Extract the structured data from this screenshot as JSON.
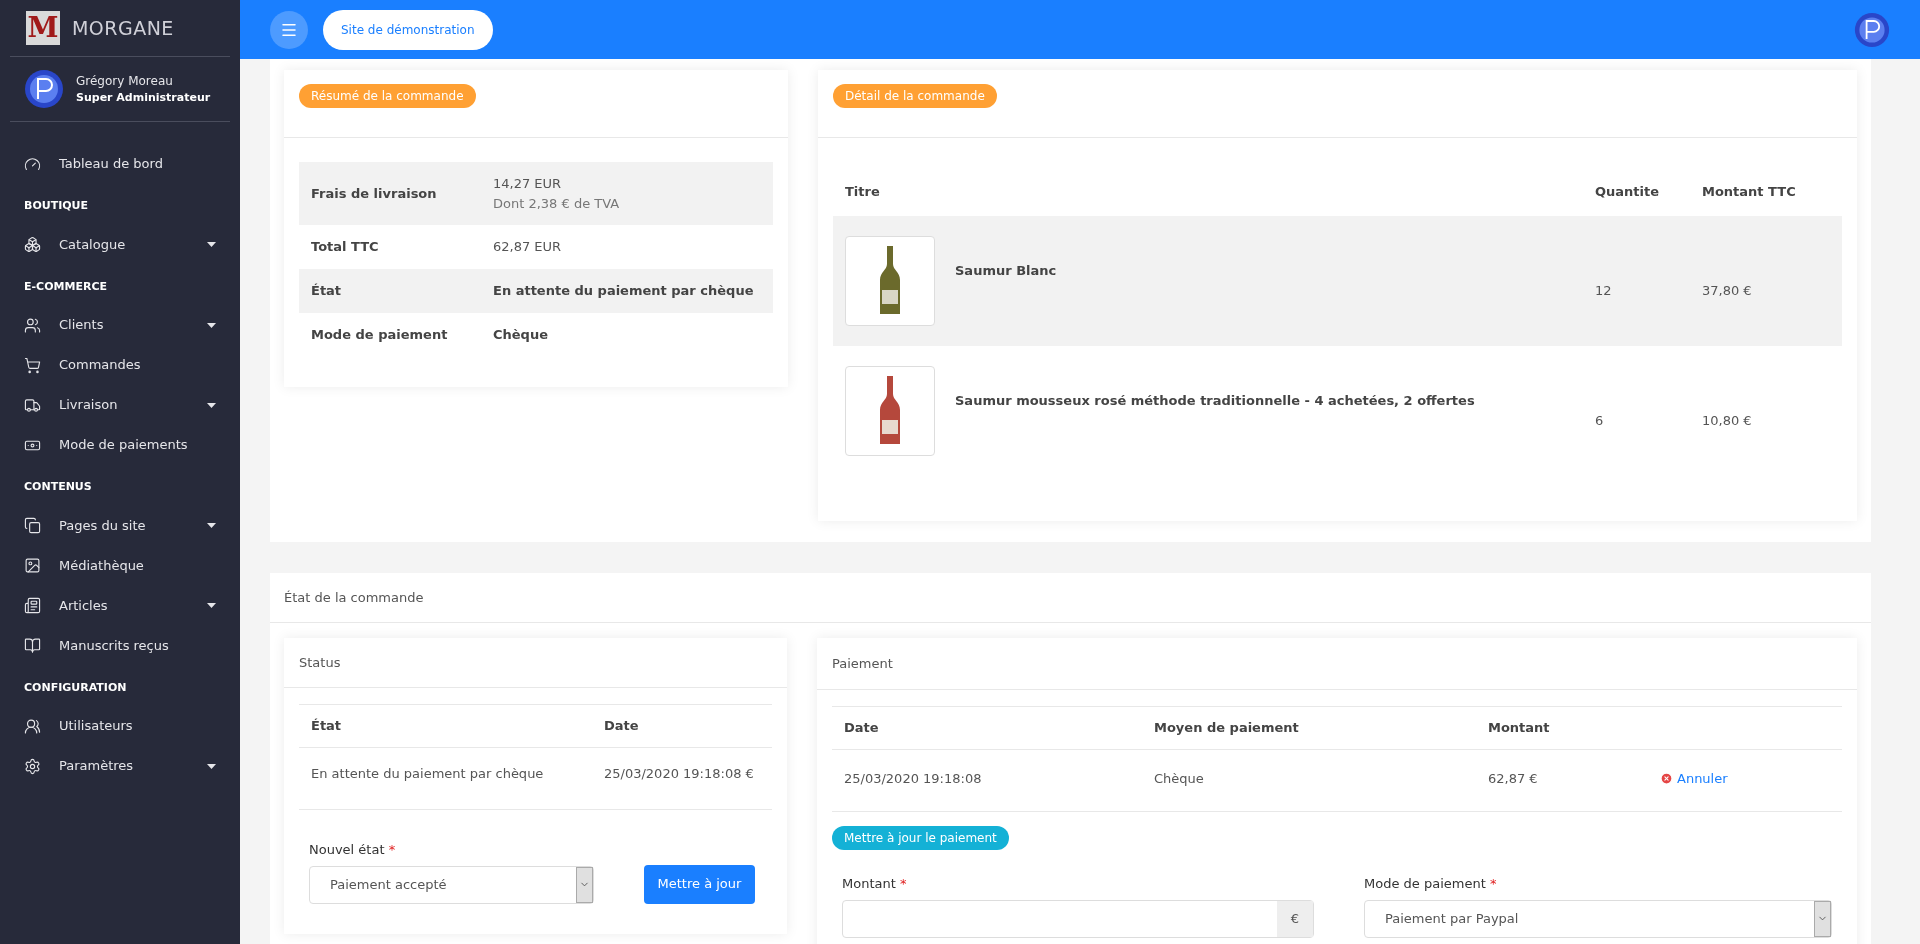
{
  "brand": {
    "logo_letter": "M",
    "name": "MORGANE"
  },
  "user": {
    "name": "Grégory Moreau",
    "role": "Super Administrateur"
  },
  "sidebar": {
    "items": [
      {
        "kind": "item",
        "label": "Tableau de bord",
        "expandable": false
      },
      {
        "kind": "section",
        "label": "BOUTIQUE"
      },
      {
        "kind": "item",
        "label": "Catalogue",
        "expandable": true
      },
      {
        "kind": "section",
        "label": "E-COMMERCE"
      },
      {
        "kind": "item",
        "label": "Clients",
        "expandable": true
      },
      {
        "kind": "item",
        "label": "Commandes",
        "expandable": false
      },
      {
        "kind": "item",
        "label": "Livraison",
        "expandable": true
      },
      {
        "kind": "item",
        "label": "Mode de paiements",
        "expandable": false
      },
      {
        "kind": "section",
        "label": "CONTENUS"
      },
      {
        "kind": "item",
        "label": "Pages du site",
        "expandable": true
      },
      {
        "kind": "item",
        "label": "Médiathèque",
        "expandable": false
      },
      {
        "kind": "item",
        "label": "Articles",
        "expandable": true
      },
      {
        "kind": "item",
        "label": "Manuscrits reçus",
        "expandable": false
      },
      {
        "kind": "section",
        "label": "CONFIGURATION"
      },
      {
        "kind": "item",
        "label": "Utilisateurs",
        "expandable": false
      },
      {
        "kind": "item",
        "label": "Paramètres",
        "expandable": true
      }
    ]
  },
  "topbar": {
    "site_button": "Site de démonstration"
  },
  "summary": {
    "badge": "Résumé de la commande",
    "rows": [
      {
        "label": "Frais de livraison",
        "value": "14,27 EUR",
        "note": "Dont 2,38 € de TVA",
        "bold": false
      },
      {
        "label": "Total TTC",
        "value": "62,87 EUR",
        "bold": false
      },
      {
        "label": "État",
        "value": "En attente du paiement par chèque",
        "bold": true
      },
      {
        "label": "Mode de paiement",
        "value": "Chèque",
        "bold": true
      }
    ]
  },
  "detail": {
    "badge": "Détail de la commande",
    "columns": [
      "Titre",
      "Quantite",
      "Montant TTC"
    ],
    "rows": [
      {
        "kind": "still",
        "title": "Saumur Blanc",
        "quantity": "12",
        "amount": "37,80 €"
      },
      {
        "kind": "sparkling",
        "title": "Saumur mousseux rosé méthode traditionnelle - 4 achetées, 2 offertes",
        "quantity": "6",
        "amount": "10,80 €"
      }
    ]
  },
  "order_state": {
    "title": "État de la commande",
    "status": {
      "title": "Status",
      "columns": [
        "État",
        "Date"
      ],
      "rows": [
        [
          "En attente du paiement par chèque",
          "25/03/2020 19:18:08 €"
        ]
      ],
      "new_state_label": "Nouvel état",
      "required_mark": "*",
      "new_state_value": "Paiement accepté",
      "button": "Mettre à jour"
    },
    "payment": {
      "title": "Paiement",
      "columns": [
        "Date",
        "Moyen de paiement",
        "Montant"
      ],
      "rows": [
        {
          "date": "25/03/2020 19:18:08",
          "method": "Chèque",
          "amount": "62,87 €",
          "action": "Annuler"
        }
      ],
      "badge": "Mettre à jour le paiement",
      "amount_label": "Montant",
      "required_mark": "*",
      "currency": "€",
      "mode_label": "Mode de paiement",
      "mode_value": "Paiement par Paypal"
    }
  }
}
